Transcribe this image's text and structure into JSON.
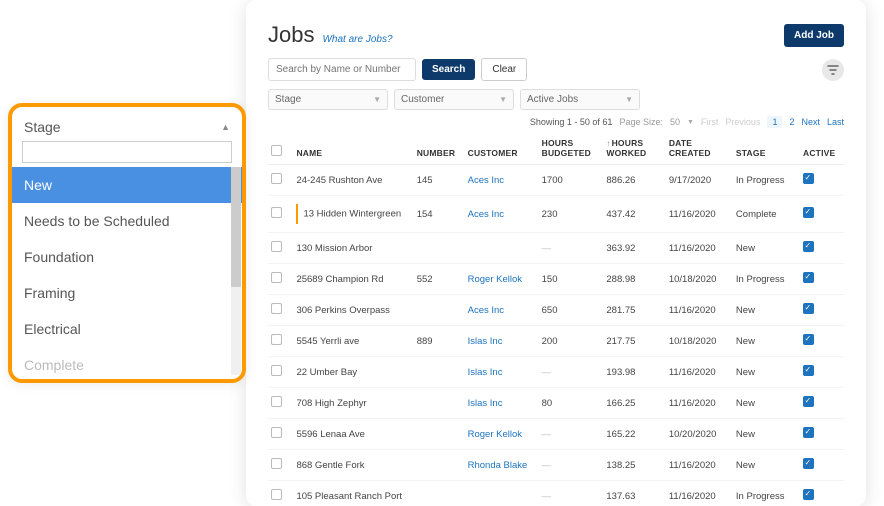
{
  "header": {
    "title": "Jobs",
    "subtitle": "What are Jobs?",
    "add_button": "Add Job"
  },
  "search": {
    "placeholder": "Search by Name or Number",
    "search_btn": "Search",
    "clear_btn": "Clear"
  },
  "filters": {
    "stage": "Stage",
    "customer": "Customer",
    "status": "Active Jobs"
  },
  "pager": {
    "showing": "Showing 1 - 50 of 61",
    "page_size_label": "Page Size:",
    "page_size_value": "50",
    "first": "First",
    "previous": "Previous",
    "page1": "1",
    "page2": "2",
    "next": "Next",
    "last": "Last"
  },
  "columns": {
    "name": "NAME",
    "number": "NUMBER",
    "customer": "CUSTOMER",
    "hours_budgeted": "HOURS BUDGETED",
    "hours_worked": "HOURS WORKED",
    "date_created": "DATE CREATED",
    "stage": "STAGE",
    "active": "ACTIVE"
  },
  "rows": [
    {
      "name": "24-245 Rushton Ave",
      "number": "145",
      "customer": "Aces Inc",
      "hb": "1700",
      "hw": "886.26",
      "date": "9/17/2020",
      "stage": "In Progress",
      "active": true,
      "indicator": false
    },
    {
      "name": "13 Hidden Wintergreen",
      "number": "154",
      "customer": "Aces Inc",
      "hb": "230",
      "hw": "437.42",
      "date": "11/16/2020",
      "stage": "Complete",
      "active": true,
      "indicator": true
    },
    {
      "name": "130 Mission Arbor",
      "number": "",
      "customer": "",
      "hb": "—",
      "hw": "363.92",
      "date": "11/16/2020",
      "stage": "New",
      "active": true,
      "indicator": false
    },
    {
      "name": "25689 Champion Rd",
      "number": "552",
      "customer": "Roger Kellok",
      "hb": "150",
      "hw": "288.98",
      "date": "10/18/2020",
      "stage": "In Progress",
      "active": true,
      "indicator": false
    },
    {
      "name": "306 Perkins Overpass",
      "number": "",
      "customer": "Aces Inc",
      "hb": "650",
      "hw": "281.75",
      "date": "11/16/2020",
      "stage": "New",
      "active": true,
      "indicator": false
    },
    {
      "name": "5545 Yerrli ave",
      "number": "889",
      "customer": "Islas Inc",
      "hb": "200",
      "hw": "217.75",
      "date": "10/18/2020",
      "stage": "New",
      "active": true,
      "indicator": false
    },
    {
      "name": "22 Umber Bay",
      "number": "",
      "customer": "Islas Inc",
      "hb": "—",
      "hw": "193.98",
      "date": "11/16/2020",
      "stage": "New",
      "active": true,
      "indicator": false
    },
    {
      "name": "708 High Zephyr",
      "number": "",
      "customer": "Islas Inc",
      "hb": "80",
      "hw": "166.25",
      "date": "11/16/2020",
      "stage": "New",
      "active": true,
      "indicator": false
    },
    {
      "name": "5596 Lenaa Ave",
      "number": "",
      "customer": "Roger Kellok",
      "hb": "—",
      "hw": "165.22",
      "date": "10/20/2020",
      "stage": "New",
      "active": true,
      "indicator": false
    },
    {
      "name": "868 Gentle Fork",
      "number": "",
      "customer": "Rhonda Blake",
      "hb": "—",
      "hw": "138.25",
      "date": "11/16/2020",
      "stage": "New",
      "active": true,
      "indicator": false
    },
    {
      "name": "105 Pleasant Ranch Port",
      "number": "",
      "customer": "",
      "hb": "—",
      "hw": "137.63",
      "date": "11/16/2020",
      "stage": "In Progress",
      "active": true,
      "indicator": false
    }
  ],
  "dropdown": {
    "label": "Stage",
    "items": [
      "New",
      "Needs to be Scheduled",
      "Foundation",
      "Framing",
      "Electrical",
      "Complete"
    ],
    "selected_index": 0
  }
}
